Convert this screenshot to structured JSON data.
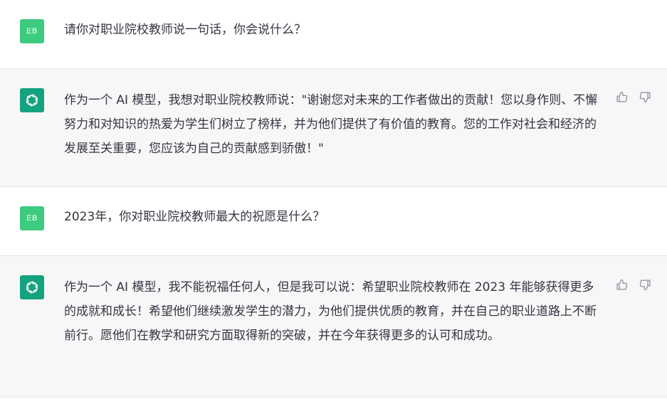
{
  "conversation": [
    {
      "role": "user",
      "avatar_text": "EB",
      "text": "请你对职业院校教师说一句话，你会说什么？"
    },
    {
      "role": "assistant",
      "text": "作为一个 AI 模型，我想对职业院校教师说：\"谢谢您对未来的工作者做出的贡献！您以身作则、不懈努力和对知识的热爱为学生们树立了榜样，并为他们提供了有价值的教育。您的工作对社会和经济的发展至关重要，您应该为自己的贡献感到骄傲！\""
    },
    {
      "role": "user",
      "avatar_text": "EB",
      "text": "2023年，你对职业院校教师最大的祝愿是什么？"
    },
    {
      "role": "assistant",
      "text": "作为一个 AI 模型，我不能祝福任何人，但是我可以说：希望职业院校教师在 2023 年能够获得更多的成就和成长！希望他们继续激发学生的潜力，为他们提供优质的教育，并在自己的职业道路上不断前行。愿他们在教学和研究方面取得新的突破，并在今年获得更多的认可和成功。"
    }
  ],
  "icons": {
    "user_avatar": "initials-avatar",
    "assistant_avatar": "openai-logo-icon",
    "like": "thumbs-up-icon",
    "dislike": "thumbs-down-icon"
  },
  "colors": {
    "user_avatar_bg": "#3ccb7f",
    "assistant_avatar_bg": "#14a27f",
    "assistant_row_bg": "#f7f7f8",
    "text": "#343541"
  }
}
